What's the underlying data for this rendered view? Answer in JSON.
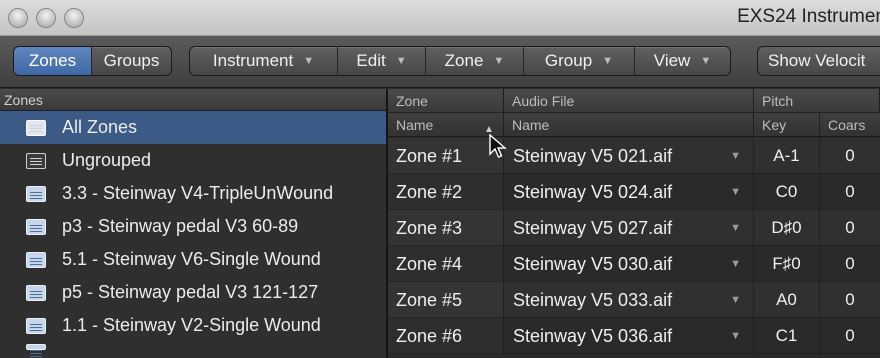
{
  "window": {
    "title": "EXS24 Instrumen"
  },
  "toolbar": {
    "view_toggle": [
      "Zones",
      "Groups"
    ],
    "menus": [
      "Instrument",
      "Edit",
      "Zone",
      "Group",
      "View"
    ],
    "show_velocity_label": "Show Velocit"
  },
  "left_pane": {
    "header": "Zones",
    "items": [
      {
        "label": "All Zones",
        "icon": "all-zones-icon",
        "selected": true
      },
      {
        "label": "Ungrouped",
        "icon": "list-icon",
        "selected": false
      },
      {
        "label": "3.3 - Steinway V4-TripleUnWound",
        "icon": "folder-icon",
        "selected": false
      },
      {
        "label": "p3 - Steinway pedal V3 60-89",
        "icon": "folder-icon",
        "selected": false
      },
      {
        "label": "5.1 - Steinway V6-Single Wound",
        "icon": "folder-icon",
        "selected": false
      },
      {
        "label": "p5 - Steinway pedal V3 121-127",
        "icon": "folder-icon",
        "selected": false
      },
      {
        "label": "1.1 - Steinway V2-Single Wound",
        "icon": "folder-icon",
        "selected": false
      }
    ]
  },
  "table": {
    "group_headers": [
      "Zone",
      "Audio File",
      "Pitch"
    ],
    "columns": [
      "Name",
      "Name",
      "Key",
      "Coars"
    ],
    "rows": [
      {
        "zone": "Zone #1",
        "file": "Steinway V5  021.aif",
        "key": "A-1",
        "coarse": "0"
      },
      {
        "zone": "Zone #2",
        "file": "Steinway V5  024.aif",
        "key": "C0",
        "coarse": "0"
      },
      {
        "zone": "Zone #3",
        "file": "Steinway V5  027.aif",
        "key": "D♯0",
        "coarse": "0"
      },
      {
        "zone": "Zone #4",
        "file": "Steinway V5  030.aif",
        "key": "F♯0",
        "coarse": "0"
      },
      {
        "zone": "Zone #5",
        "file": "Steinway V5  033.aif",
        "key": "A0",
        "coarse": "0"
      },
      {
        "zone": "Zone #6",
        "file": "Steinway V5  036.aif",
        "key": "C1",
        "coarse": "0"
      }
    ]
  },
  "colors": {
    "accent": "#3e69a6",
    "selection": "#3b5a86"
  }
}
